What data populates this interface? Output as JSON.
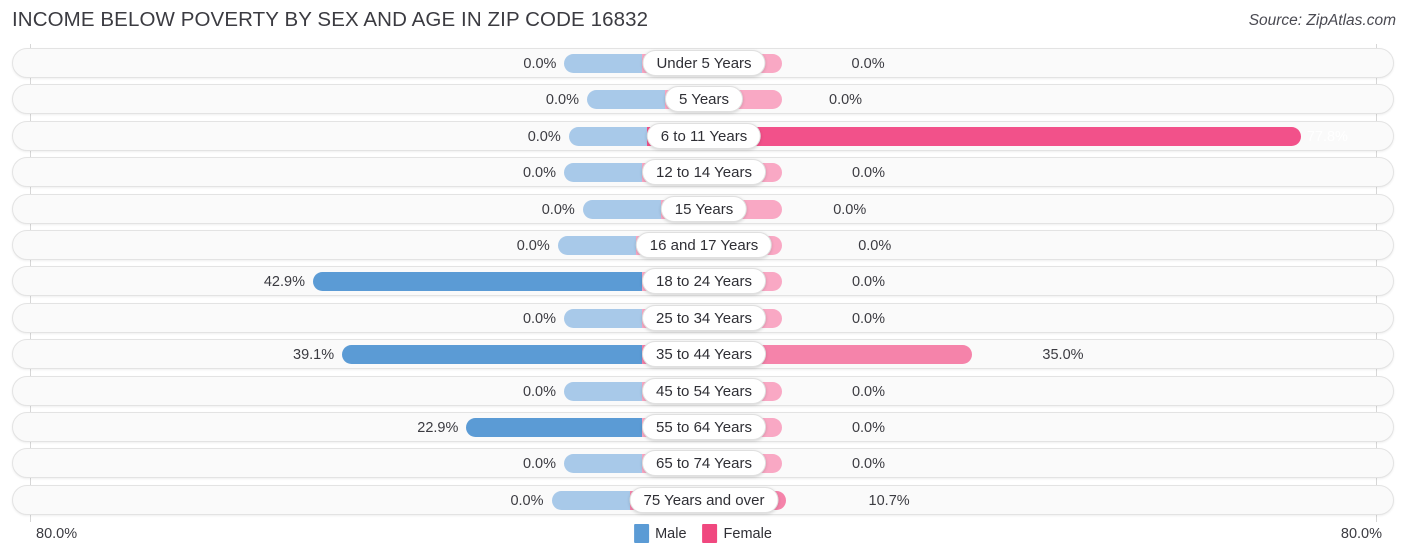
{
  "header": {
    "title": "INCOME BELOW POVERTY BY SEX AND AGE IN ZIP CODE 16832",
    "source": "Source: ZipAtlas.com"
  },
  "footer": {
    "axis_left": "80.0%",
    "axis_right": "80.0%",
    "legend": [
      {
        "label": "Male",
        "color": "#5b9bd5"
      },
      {
        "label": "Female",
        "color": "#f0487f"
      }
    ]
  },
  "colors": {
    "male": "#5b9bd5",
    "male_zero": "#a8c9e9",
    "female": "#f583aa",
    "female_zero": "#f9a8c4",
    "female_high": "#f2518a",
    "row_bg": "#fafafa",
    "gridline": "#d7d7d7",
    "text": "#3b3b41"
  },
  "chart_data": {
    "type": "bar",
    "orientation": "horizontal",
    "style": "diverging-butterfly",
    "title": "INCOME BELOW POVERTY BY SEX AND AGE IN ZIP CODE 16832",
    "xlabel": "",
    "ylabel": "",
    "xlim": [
      80.0,
      80.0
    ],
    "axis_max_left": 80.0,
    "axis_max_right": 80.0,
    "grid": true,
    "legend_position": "bottom-center",
    "categories": [
      "Under 5 Years",
      "5 Years",
      "6 to 11 Years",
      "12 to 14 Years",
      "15 Years",
      "16 and 17 Years",
      "18 to 24 Years",
      "25 to 34 Years",
      "35 to 44 Years",
      "45 to 54 Years",
      "55 to 64 Years",
      "65 to 74 Years",
      "75 Years and over"
    ],
    "series": [
      {
        "name": "Male",
        "side": "left",
        "values": [
          0.0,
          0.0,
          0.0,
          0.0,
          0.0,
          0.0,
          42.9,
          0.0,
          39.1,
          0.0,
          22.9,
          0.0,
          0.0
        ],
        "labels": [
          "0.0%",
          "0.0%",
          "0.0%",
          "0.0%",
          "0.0%",
          "0.0%",
          "42.9%",
          "0.0%",
          "39.1%",
          "0.0%",
          "22.9%",
          "0.0%",
          "0.0%"
        ]
      },
      {
        "name": "Female",
        "side": "right",
        "values": [
          0.0,
          0.0,
          77.8,
          0.0,
          0.0,
          0.0,
          0.0,
          0.0,
          35.0,
          0.0,
          0.0,
          0.0,
          10.7
        ],
        "labels": [
          "0.0%",
          "0.0%",
          "77.8%",
          "0.0%",
          "0.0%",
          "0.0%",
          "0.0%",
          "0.0%",
          "35.0%",
          "0.0%",
          "0.0%",
          "0.0%",
          "10.7%"
        ]
      }
    ]
  }
}
